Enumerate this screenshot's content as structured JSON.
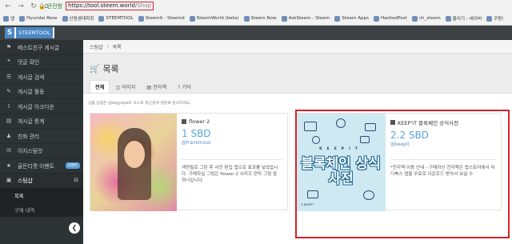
{
  "browser": {
    "back": "←",
    "forward": "→",
    "reload": "↻",
    "home": "⌂",
    "security_label": "안전함",
    "url_host": "https://tool.steem.world",
    "url_path": "/Shop",
    "bookmarks": [
      "앱",
      "Hyundai Rese",
      "산림생태학회",
      "STEEMTOOL",
      "Steemit - Steemd",
      "SteemWorld (beta)",
      "Steem Now",
      "AskSteem - Steem",
      "Steem Apps",
      "HashedPost",
      "ch_steem",
      "올리기 - 네이버",
      "쿠팡!"
    ]
  },
  "app": {
    "brand_letter": "S",
    "brand_text": "STEEMTOOL"
  },
  "sidebar": {
    "items": [
      {
        "icon": "⚑",
        "label": "베스트친구 게시글"
      },
      {
        "icon": "❝",
        "label": "댓글 확인"
      },
      {
        "icon": "☰",
        "label": "게시글 검색"
      },
      {
        "icon": "✎",
        "label": "게시글 활동"
      },
      {
        "icon": "⇩",
        "label": "게시글 아크다운"
      },
      {
        "icon": "▤",
        "label": "게시글 통계"
      },
      {
        "icon": "♟",
        "label": "친화 관리"
      },
      {
        "icon": "✉",
        "label": "이지스팀잇"
      },
      {
        "icon": "★",
        "label": "골든티켓 이벤트",
        "badge": "이벤트"
      }
    ],
    "active": {
      "icon": "▣",
      "label": "스팀샵",
      "toggle": "⊟"
    },
    "subitems": [
      {
        "label": "목록"
      },
      {
        "label": "구매 내역"
      }
    ],
    "collapse": "❮"
  },
  "breadcrumb": {
    "root": "스팀샵",
    "sep": "/",
    "current": "목록"
  },
  "page": {
    "title_icon": "🛒",
    "title": "목록"
  },
  "tabs": [
    {
      "label": "전체",
      "active": true
    },
    {
      "label": "◫ 이미지"
    },
    {
      "label": "▤ 전자책"
    },
    {
      "label": "? 기타"
    }
  ],
  "note": "상품 입점은 @segyepark 포스트 최근글에 댓글로 문의하세요.",
  "products": [
    {
      "type_icon": "image",
      "title": "flower 2",
      "price": "1 SBD",
      "author": "@frankmsoo",
      "desc": "색연필로 그린 후 사진 편집 앱으로 효과를 넣었습니다. 구매하실 그림은 flower 2 시리즈 연작 그림 중 하나입니다."
    },
    {
      "type_icon": "book",
      "title": "KEEP'IT 블록체인 상식사전",
      "price": "2.2 SBD",
      "author": "@keepit",
      "desc": "*전자책 이용 안내 - 구매하신 전자책은 앱스토어에서 리디북스 앱을 무료로 다운로드 받아서 보실 수",
      "cover_keepit": "KEEPIT",
      "cover_title": "블록체인 상식사전",
      "cover_foot": "3.KEEPIT"
    }
  ],
  "colors": {
    "accent": "#58a6db",
    "highlight": "#d4232b",
    "sidebar": "#2d3235"
  }
}
